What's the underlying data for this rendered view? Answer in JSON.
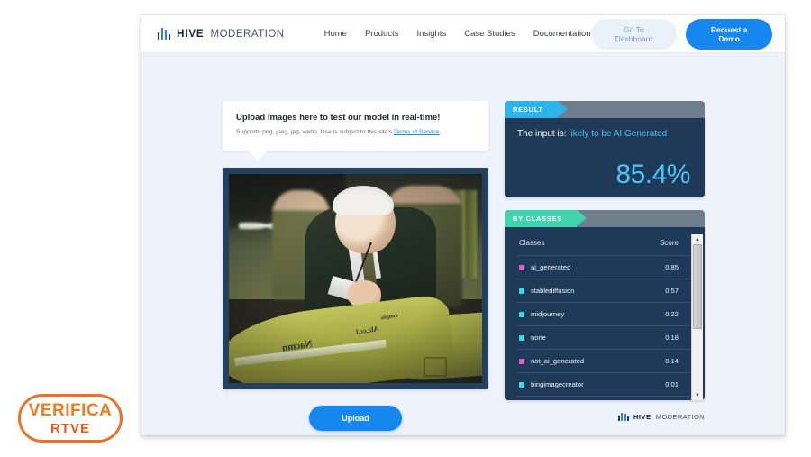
{
  "header": {
    "brand_primary": "HIVE",
    "brand_secondary": "MODERATION",
    "nav": [
      {
        "label": "Home"
      },
      {
        "label": "Products"
      },
      {
        "label": "Insights"
      },
      {
        "label": "Case Studies"
      },
      {
        "label": "Documentation"
      }
    ],
    "dashboard_button": "Go To Dashboard",
    "demo_button": "Request a Demo"
  },
  "upload": {
    "title": "Upload images here to test our model in real-time!",
    "subtitle_pre": "Supports png, jpeg, jpg, webp. Use is subject to this site's ",
    "subtitle_link": "Terms of Service",
    "subtitle_post": ".",
    "button_label": "Upload"
  },
  "photo": {
    "description": "Man with white hair in a dark green suit laughing while signing an olive-green artillery shell; camouflaged soldiers in the background",
    "shell_text_1": "Nacmn",
    "shell_text_2": "Ala.cc.l",
    "shell_text_3": "coupla"
  },
  "result": {
    "tab_label": "RESULT",
    "prefix": "The input is:",
    "verdict": "likely to be AI Generated",
    "score": "85.4%",
    "accent_color": "#4fc3f7",
    "tab_color": "#2bb6ea"
  },
  "classes": {
    "tab_label": "BY CLASSES",
    "tab_color": "#3fd3ae",
    "col_class": "Classes",
    "col_score": "Score",
    "rows": [
      {
        "name": "ai_generated",
        "score": "0.85",
        "color": "#e05fd0"
      },
      {
        "name": "stablediffusion",
        "score": "0.57",
        "color": "#3fd7e0"
      },
      {
        "name": "midjourney",
        "score": "0.22",
        "color": "#3fd7e0"
      },
      {
        "name": "none",
        "score": "0.18",
        "color": "#3fd7e0"
      },
      {
        "name": "not_ai_generated",
        "score": "0.14",
        "color": "#e05fd0"
      },
      {
        "name": "bingimagecreator",
        "score": "0.01",
        "color": "#3fd7e0"
      }
    ],
    "scroll_up": "▲",
    "scroll_down": "▼"
  },
  "footer": {
    "brand_primary": "HIVE",
    "brand_secondary": "MODERATION"
  },
  "watermark": {
    "line1": "VERIFICA",
    "line2": "RTVE",
    "color": "#e8722a"
  }
}
